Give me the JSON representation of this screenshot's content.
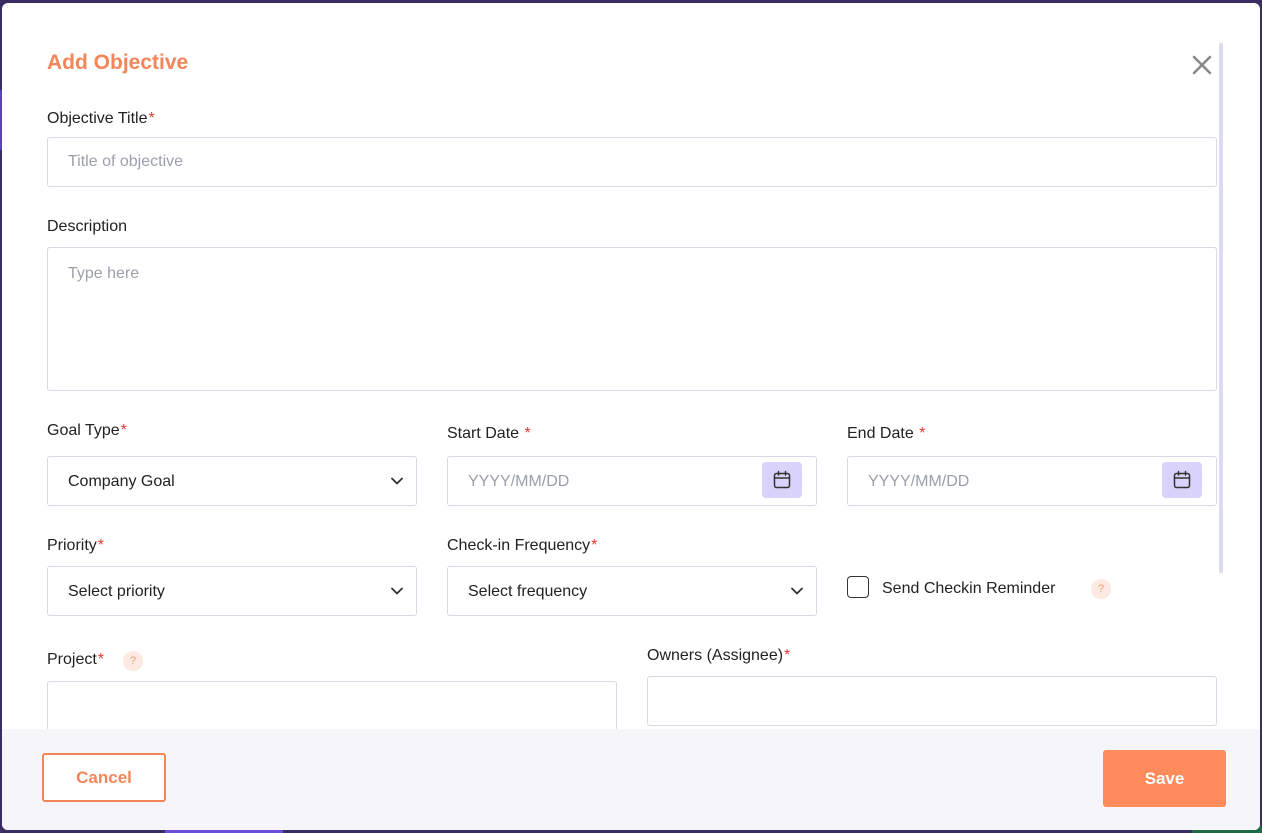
{
  "modal": {
    "title": "Add Objective"
  },
  "form": {
    "objective_title": {
      "label": "Objective Title",
      "required_mark": "*",
      "placeholder": "Title of objective"
    },
    "description": {
      "label": "Description",
      "placeholder": "Type here"
    },
    "goal_type": {
      "label": "Goal Type",
      "required_mark": "*",
      "value": "Company Goal"
    },
    "start_date": {
      "label": "Start Date",
      "required_mark": "*",
      "placeholder": "YYYY/MM/DD"
    },
    "end_date": {
      "label": "End Date",
      "required_mark": "*",
      "placeholder": "YYYY/MM/DD"
    },
    "priority": {
      "label": "Priority",
      "required_mark": "*",
      "value": "Select priority"
    },
    "checkin_frequency": {
      "label": "Check-in Frequency",
      "required_mark": "*",
      "value": "Select frequency"
    },
    "send_checkin_reminder": {
      "label": "Send Checkin Reminder",
      "checked": false,
      "help": "?"
    },
    "project": {
      "label": "Project",
      "required_mark": "*",
      "help": "?"
    },
    "owners": {
      "label": "Owners (Assignee)",
      "required_mark": "*"
    }
  },
  "footer": {
    "cancel_label": "Cancel",
    "save_label": "Save"
  },
  "colors": {
    "accent": "#f2855a",
    "save_button": "#ff8a5c",
    "required": "#e53935",
    "calendar_button": "#d9d3fb"
  }
}
